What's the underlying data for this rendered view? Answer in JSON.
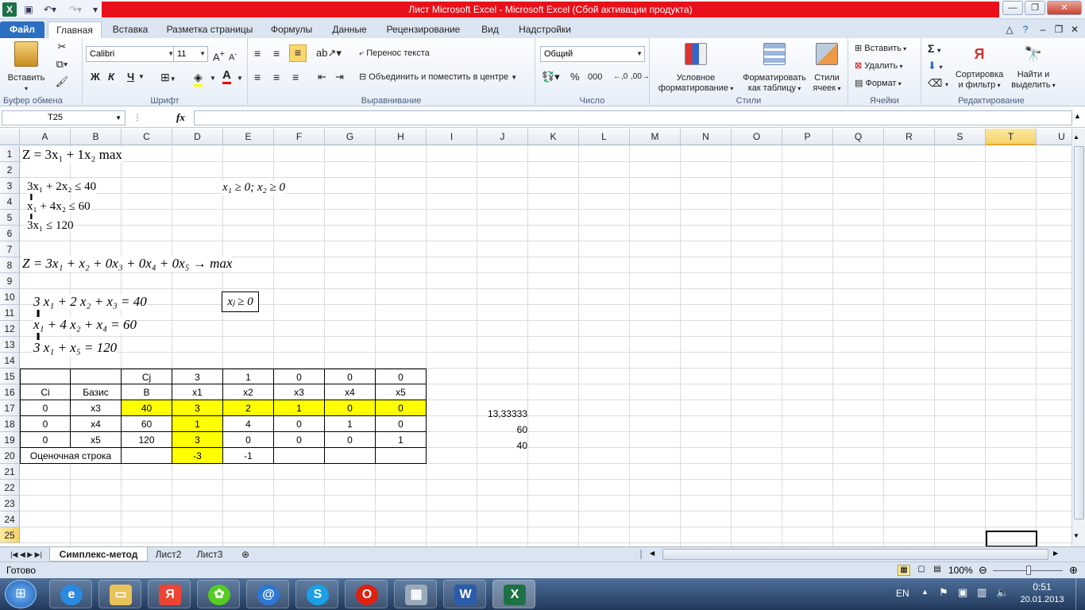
{
  "window": {
    "title": "Лист Microsoft Excel  -  Microsoft Excel (Сбой активации продукта)"
  },
  "tabs": [
    "Файл",
    "Главная",
    "Вставка",
    "Разметка страницы",
    "Формулы",
    "Данные",
    "Рецензирование",
    "Вид",
    "Надстройки"
  ],
  "ribbon": {
    "paste": "Вставить",
    "clipboard_group": "Буфер обмена",
    "font_name": "Calibri",
    "font_size": "11",
    "bold": "Ж",
    "italic": "К",
    "underline": "Ч",
    "font_group": "Шрифт",
    "wrap_text": "Перенос текста",
    "merge_center": "Объединить и поместить в центре",
    "alignment_group": "Выравнивание",
    "number_format": "Общий",
    "percent": "%",
    "thousands": "000",
    "number_group": "Число",
    "cond_format_1": "Условное",
    "cond_format_2": "форматирование",
    "format_table_1": "Форматировать",
    "format_table_2": "как таблицу",
    "cell_styles_1": "Стили",
    "cell_styles_2": "ячеек",
    "styles_group": "Стили",
    "insert": "Вставить",
    "delete": "Удалить",
    "format": "Формат",
    "cells_group": "Ячейки",
    "sort_1": "Сортировка",
    "sort_2": "и фильтр",
    "find_1": "Найти и",
    "find_2": "выделить",
    "editing_group": "Редактирование"
  },
  "formula_bar": {
    "name_box": "T25",
    "fx": "fx",
    "value": ""
  },
  "columns": [
    "A",
    "B",
    "C",
    "D",
    "E",
    "F",
    "G",
    "H",
    "I",
    "J",
    "K",
    "L",
    "M",
    "N",
    "O",
    "P",
    "Q",
    "R",
    "S",
    "T",
    "U"
  ],
  "rows": [
    "1",
    "2",
    "3",
    "4",
    "5",
    "6",
    "7",
    "8",
    "9",
    "10",
    "11",
    "12",
    "13",
    "14",
    "15",
    "16",
    "17",
    "18",
    "19",
    "20",
    "21",
    "22",
    "23",
    "24",
    "25"
  ],
  "math": {
    "objective": "Z = 3x₁ + 1x₂  max",
    "c1": "3x₁ + 2x₂ ≤ 40",
    "c2": "x₁ + 4x₂ ≤ 60",
    "c3": "3x₁ ≤ 120",
    "nonneg": "x₁ ≥ 0; x₂ ≥ 0",
    "canonical": "Z = 3x₁ + x₂ + 0x₃ + 0x₄ + 0x₅ → max",
    "e1": "3 x₁ + 2 x₂ + x₃ = 40",
    "e2": "x₁ + 4 x₂ + x₄ = 60",
    "e3": "3 x₁ + x₅ = 120",
    "xj": "xⱼ ≥ 0"
  },
  "table": {
    "r15": [
      "",
      "",
      "Cj",
      "3",
      "1",
      "0",
      "0",
      "0"
    ],
    "r16": [
      "Ci",
      "Базис",
      "B",
      "x1",
      "x2",
      "x3",
      "x4",
      "x5"
    ],
    "r17": [
      "0",
      "x3",
      "40",
      "3",
      "2",
      "1",
      "0",
      "0"
    ],
    "r18": [
      "0",
      "x4",
      "60",
      "1",
      "4",
      "0",
      "1",
      "0"
    ],
    "r19": [
      "0",
      "x5",
      "120",
      "3",
      "0",
      "0",
      "0",
      "1"
    ],
    "r20": [
      "Оценочная строка",
      "",
      "-3",
      "-1",
      "",
      "",
      ""
    ]
  },
  "ratios": {
    "j17": "13,33333",
    "j18": "60",
    "j19": "40"
  },
  "sheets": [
    "Симплекс-метод",
    "Лист2",
    "Лист3"
  ],
  "status": {
    "ready": "Готово",
    "zoom": "100%"
  },
  "taskbar": {
    "lang": "EN",
    "time": "0:51",
    "date": "20.01.2013"
  },
  "colors": {
    "highlight": "#ffff00",
    "title_bar": "#e8101a"
  }
}
